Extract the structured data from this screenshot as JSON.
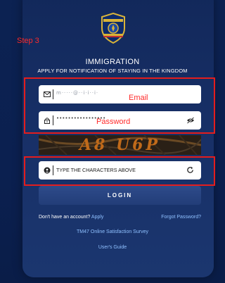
{
  "annotations": {
    "step": "Step 3",
    "email_label": "Email",
    "password_label": "Password"
  },
  "header": {
    "logo_alt": "Royal Thai Police Immigration Bureau",
    "logo_top_text": "ROYAL THAI POLICE",
    "logo_bottom_text": "IMMIGRATION BUREAU",
    "title": "IMMIGRATION",
    "subtitle": "APPLY FOR NOTIFICATION OF STAYING IN THE KINGDOM"
  },
  "form": {
    "email_value": "m·····@··i·i··i·",
    "password_value": "•••••••••••••••••",
    "captcha_text": "A8 U6P",
    "captcha_placeholder": "TYPE THE CHARACTERS ABOVE",
    "login_label": "LOGIN"
  },
  "footer": {
    "no_account_text": "Don't have an account?",
    "apply_link": "Apply",
    "forgot_password": "Forgot Password?",
    "survey_link": "TM47 Online Satisfaction Survey",
    "guide_link": "User's Guide"
  },
  "icons": {
    "email": "envelope-icon",
    "password": "lock-icon",
    "toggle": "eye-slash-icon",
    "captcha": "shield-user-icon",
    "refresh": "refresh-icon"
  },
  "colors": {
    "background": "#0a1f4a",
    "card": "#172f66",
    "annotation": "#e41d1d",
    "link": "#8fc0ff",
    "button": "#223d78"
  }
}
